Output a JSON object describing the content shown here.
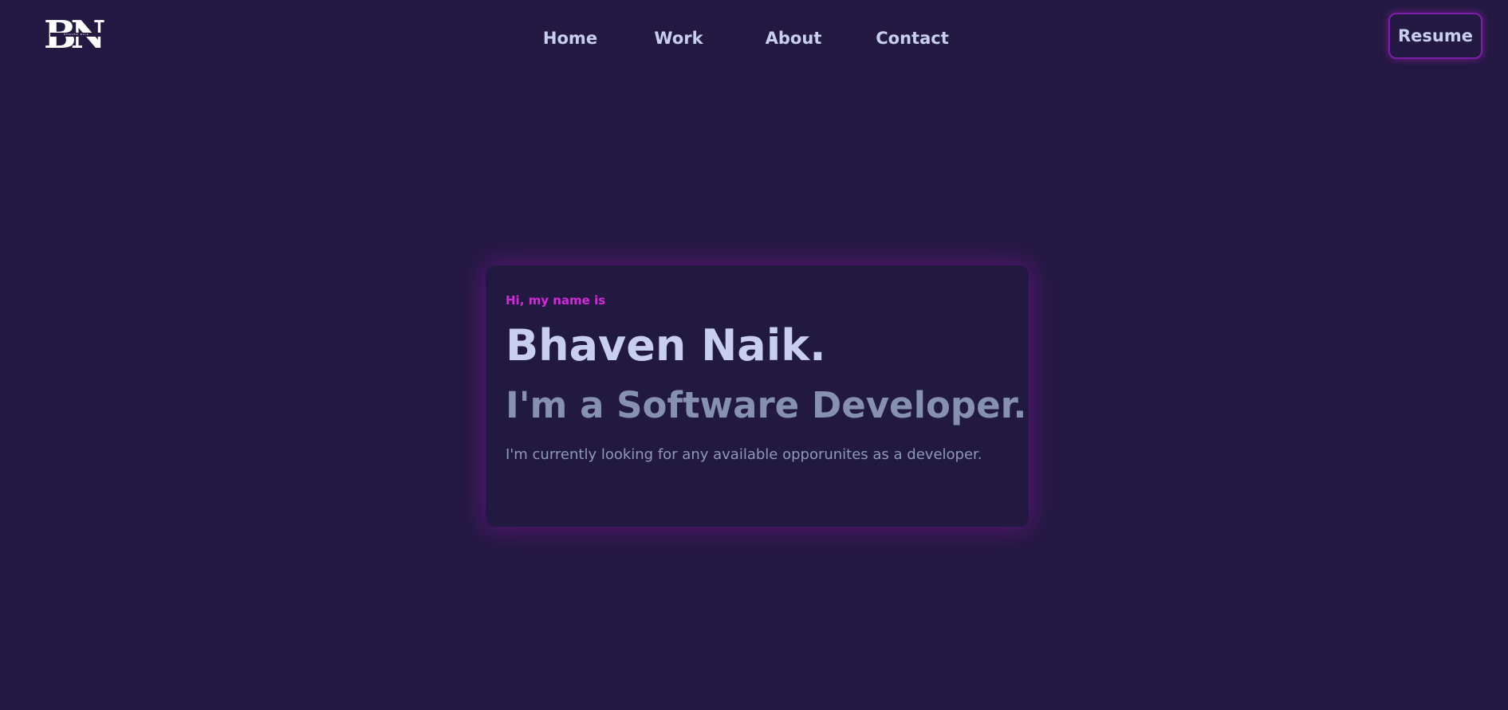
{
  "header": {
    "logo": {
      "text": "BN",
      "tagline": "BHAVEN NAIK"
    },
    "nav": [
      {
        "label": "Home"
      },
      {
        "label": "Work"
      },
      {
        "label": "About"
      },
      {
        "label": "Contact"
      }
    ],
    "resume_label": "Resume"
  },
  "hero": {
    "greeting": "Hi, my name is",
    "name": "Bhaven Naik.",
    "role": "I'm a Software Developer.",
    "description": "I'm currently looking for any available opporunites as a developer."
  },
  "colors": {
    "background": "#231942",
    "text": "#c8cfee",
    "muted": "#8590b3",
    "accent": "#d12bd8",
    "glow": "#7a1fa8"
  }
}
